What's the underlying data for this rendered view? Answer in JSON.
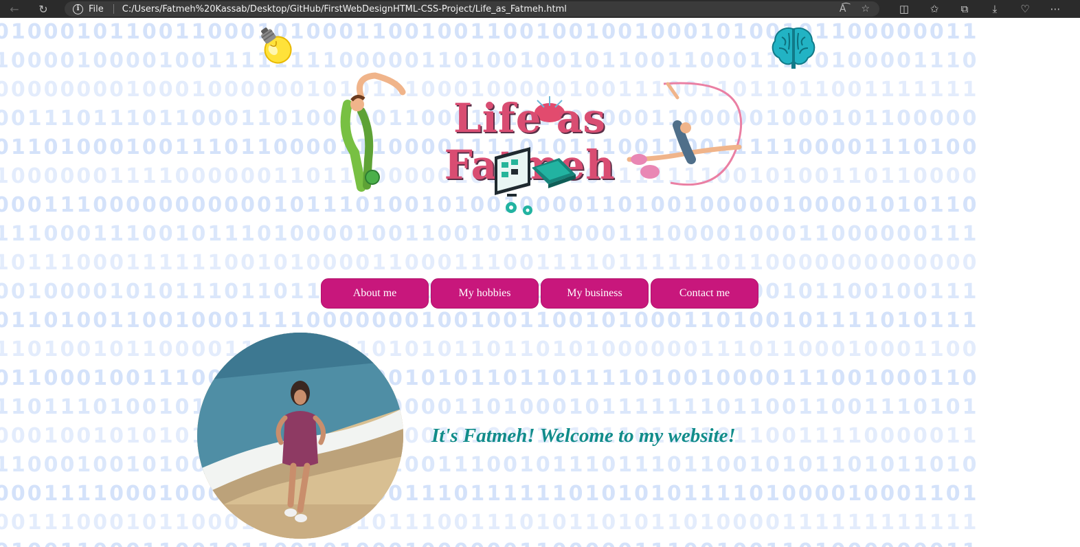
{
  "browser": {
    "scheme_label": "File",
    "url": "C:/Users/Fatmeh%20Kassab/Desktop/GitHub/FirstWebDesignHTML-CSS-Project/Life_as_Fatmeh.html",
    "icons": [
      "back-icon",
      "refresh-icon",
      "info-icon",
      "read-aloud-icon",
      "favorite-star-icon",
      "split-screen-icon",
      "favorites-icon",
      "collections-icon",
      "downloads-icon",
      "performance-icon",
      "more-icon"
    ]
  },
  "page": {
    "logo_title": "Life as Fatmeh",
    "nav": [
      {
        "label": "About me"
      },
      {
        "label": "My hobbies"
      },
      {
        "label": "My business"
      },
      {
        "label": "Contact me"
      }
    ],
    "welcome": "It's Fatmeh! Welcome to my website!",
    "colors": {
      "nav_button": "#c8177c",
      "welcome_text": "#118c8a",
      "binary_digits": "#dbe7fb",
      "browser_bar": "#2b2b2b"
    }
  }
}
